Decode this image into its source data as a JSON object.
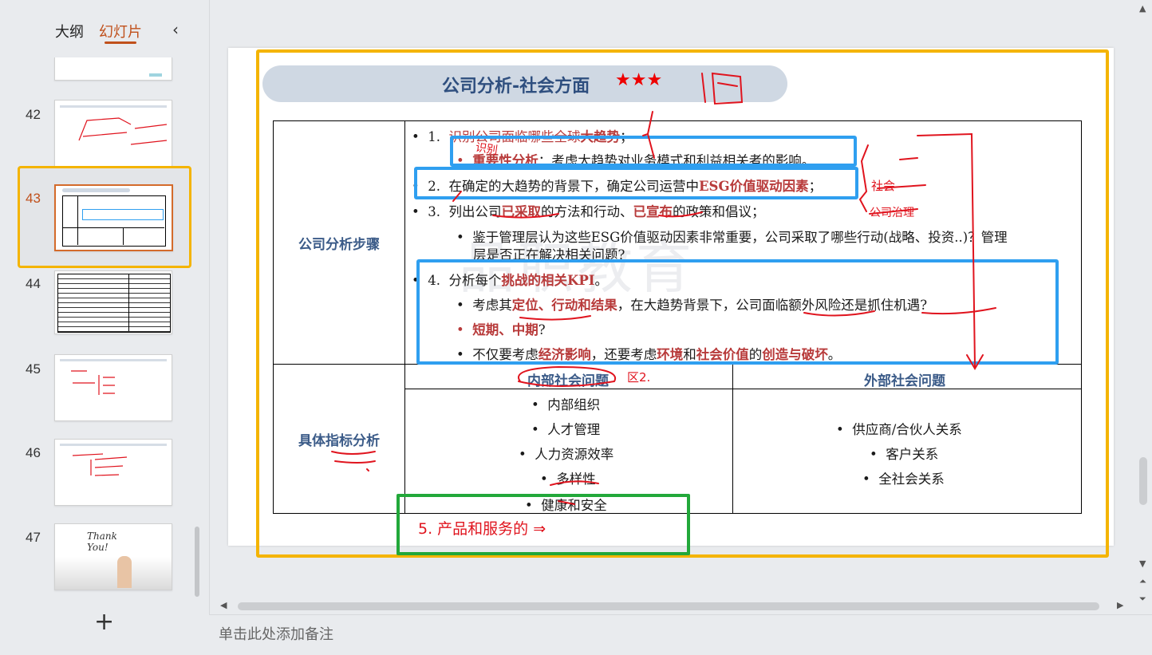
{
  "sidebar": {
    "tab_outline": "大纲",
    "tab_slides": "幻灯片",
    "collapse_icon": "chevron-left-icon",
    "slide_numbers": [
      "42",
      "43",
      "44",
      "45",
      "46",
      "47"
    ],
    "thumb_47_text": "Thank You!",
    "add_label": "+"
  },
  "slide": {
    "title": "公司分析-社会方面",
    "stars": "★★★",
    "row1_label": "公司分析步骤",
    "row2_label": "具体指标分析",
    "steps": {
      "s1_num": "1.",
      "s1_a": "识别公司面临哪些全球",
      "s1_b": "大趋势",
      "s1_c": "；",
      "s1_sub_a": "重要性分析",
      "s1_sub_b": "：考虑大趋势对业务模式和利益相关者的影响。",
      "s2_num": "2.",
      "s2_a": "在确定的大趋势的背景下，确定公司运营中",
      "s2_b": "ESG价值驱动因素",
      "s2_c": "；",
      "s3_num": "3.",
      "s3_a": "列出公司",
      "s3_b": "已采取",
      "s3_c": "的方法和行动、",
      "s3_d": "已宣布",
      "s3_e": "的政策和倡议；",
      "s3_sub1": "鉴于管理层认为这些ESG价值驱动因素非常重要，公司采取了哪些行动(战略、投资..)？管理",
      "s3_sub2": "层是否正在解决相关问题?",
      "s4_num": "4.",
      "s4_a": "分析每个",
      "s4_b": "挑战的相关KPI",
      "s4_c": "。",
      "s4_sub1_a": "考虑其",
      "s4_sub1_b": "定位、行动和结果",
      "s4_sub1_c": "，在大趋势背景下，公司面临额外风险还是抓住机遇?",
      "s4_sub2_a": "短期、中期",
      "s4_sub2_b": "?",
      "s4_sub3_a": "不仅要考虑",
      "s4_sub3_b": "经济影响",
      "s4_sub3_c": "，还要考虑",
      "s4_sub3_d": "环境",
      "s4_sub3_e": "和",
      "s4_sub3_f": "社会价值",
      "s4_sub3_g": "的",
      "s4_sub3_h": "创造与破坏",
      "s4_sub3_i": "。"
    },
    "internal_header": "内部社会问题",
    "external_header": "外部社会问题",
    "internal_items": [
      "内部组织",
      "人才管理",
      "人力资源效率",
      "多样性",
      "健康和安全"
    ],
    "external_items": [
      "供应商/合伙人关系",
      "客户关系",
      "全社会关系"
    ],
    "watermark": "品职教育",
    "ink_notes": {
      "n1": "识别",
      "n2": "社会",
      "n3": "公司治理",
      "n4": "5. 产品和服务的 ⇒",
      "n5": "区2."
    }
  },
  "notes_placeholder": "单击此处添加备注",
  "colors": {
    "accent": "#c0501b",
    "highlight_yellow": "#f4b400",
    "highlight_blue": "#2f9ff0",
    "highlight_green": "#22a83a",
    "ink_red": "#e0141e"
  }
}
